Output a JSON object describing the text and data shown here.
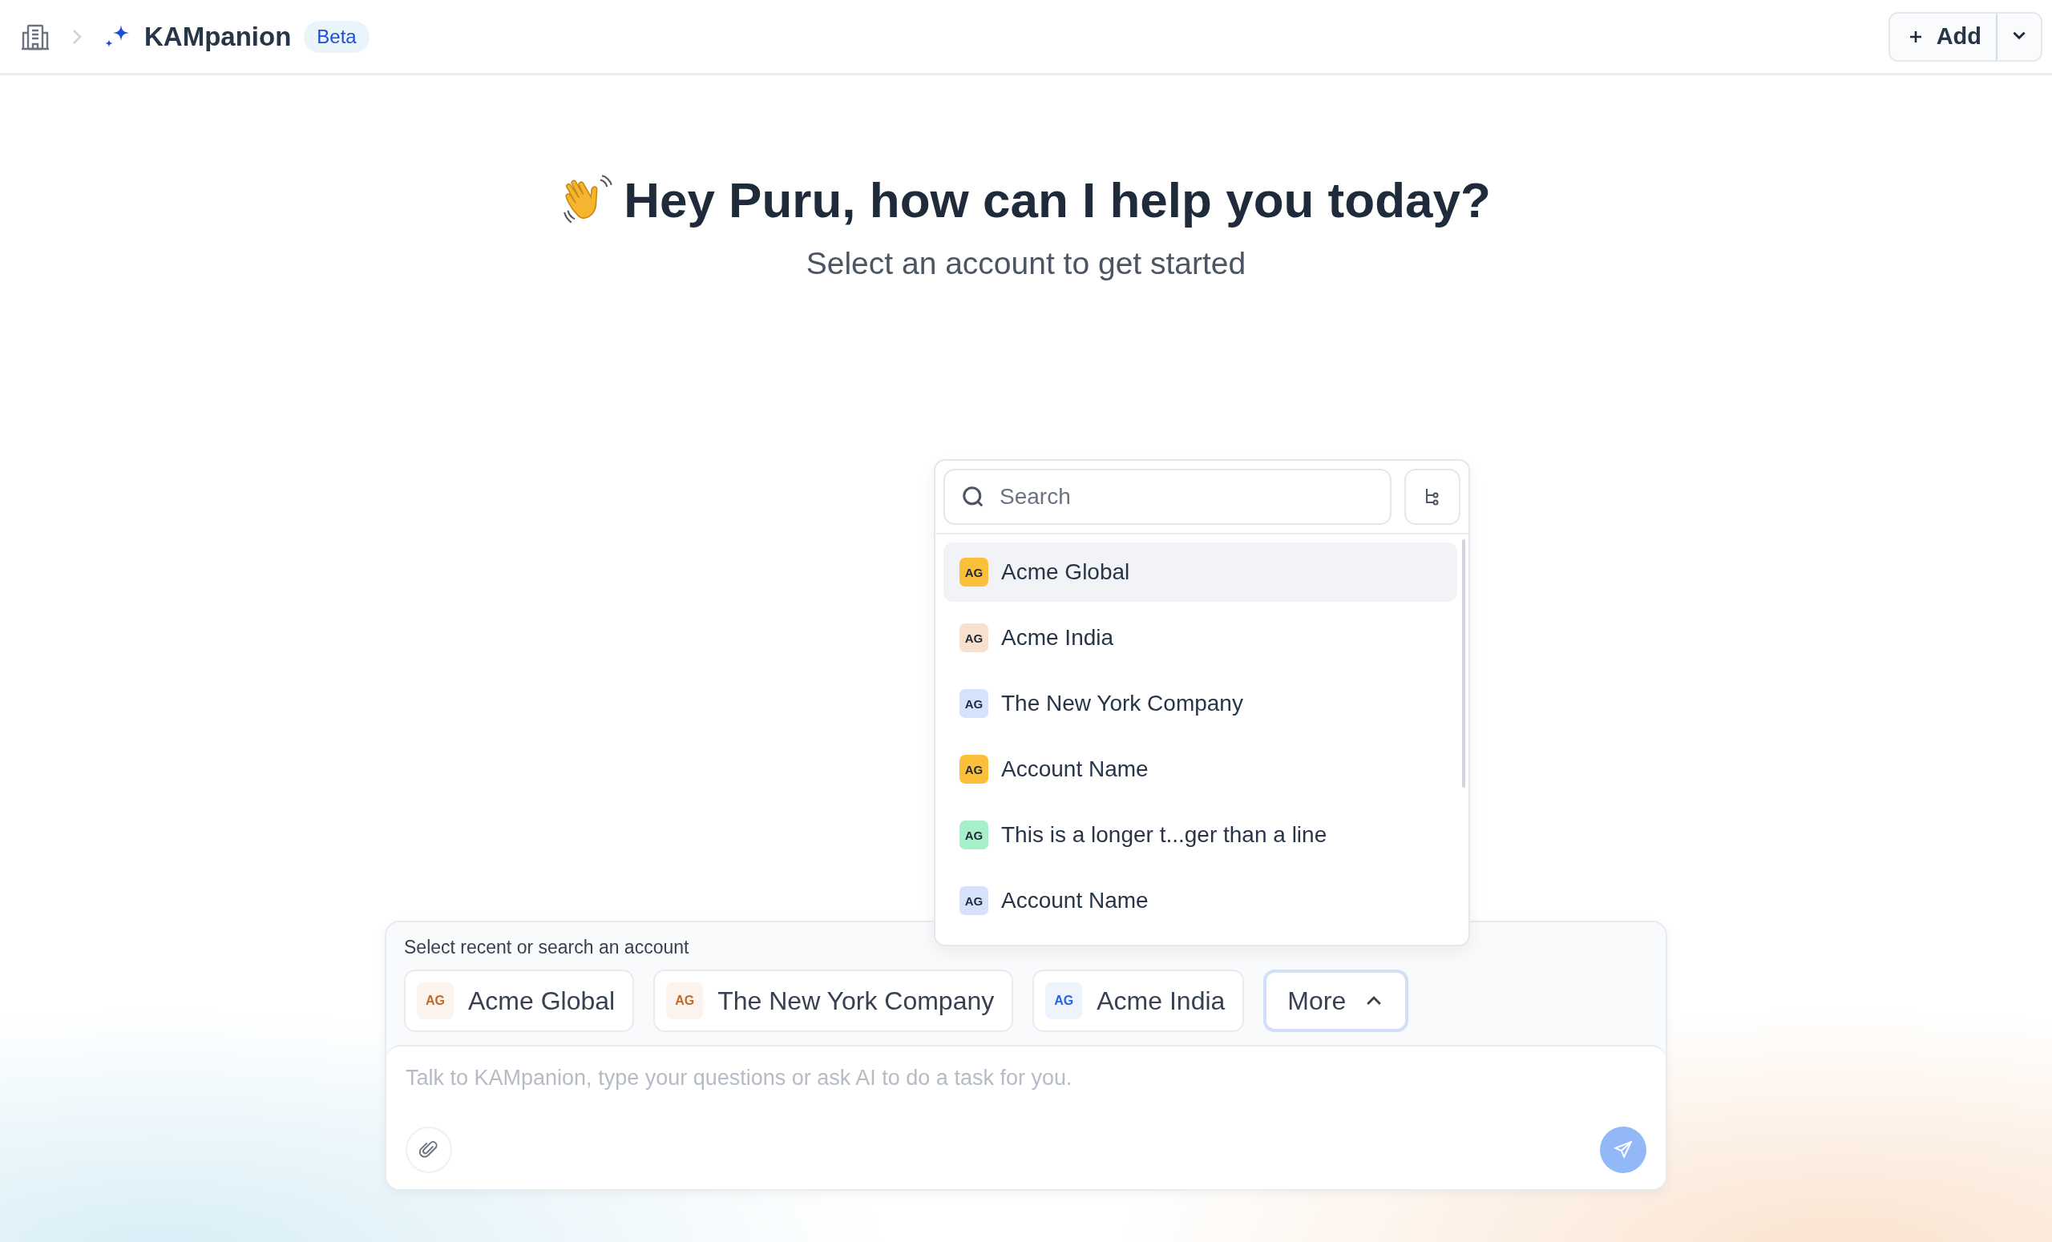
{
  "breadcrumb": {
    "title": "KAMpanion",
    "badge": "Beta"
  },
  "add_button": {
    "label": "Add"
  },
  "greeting": {
    "title": "Hey Puru, how can I help you today?",
    "subtitle": "Select an account to get started"
  },
  "dropdown": {
    "search": {
      "placeholder": "Search"
    },
    "items": [
      {
        "initials": "AG",
        "name": "Acme Global",
        "color": "#fbbf3c",
        "selected": true
      },
      {
        "initials": "AG",
        "name": "Acme India",
        "color": "#f8e0cf",
        "selected": false
      },
      {
        "initials": "AG",
        "name": "The New York Company",
        "color": "#d6e2fb",
        "selected": false
      },
      {
        "initials": "AG",
        "name": "Account Name",
        "color": "#fbbf3c",
        "selected": false
      },
      {
        "initials": "AG",
        "name": "This is a longer t...ger than a line",
        "color": "#a7efc8",
        "selected": false
      },
      {
        "initials": "AG",
        "name": "Account Name",
        "color": "#d6e2fb",
        "selected": false
      }
    ]
  },
  "composer": {
    "label": "Select recent or search an account",
    "chips": [
      {
        "initials": "AG",
        "name": "Acme Global",
        "color": "#c2692a"
      },
      {
        "initials": "AG",
        "name": "The New York Company",
        "color": "#c2692a"
      },
      {
        "initials": "AG",
        "name": "Acme India",
        "color": "#2563eb"
      }
    ],
    "more": {
      "label": "More",
      "expanded": true
    },
    "input": {
      "placeholder": "Talk to KAMpanion, type your questions or ask AI to do a task for you."
    }
  }
}
